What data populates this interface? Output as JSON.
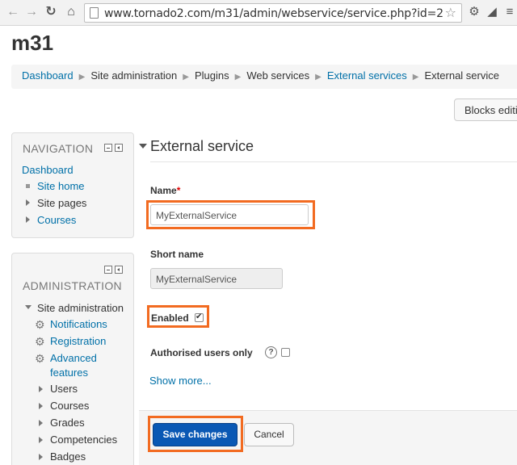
{
  "browser": {
    "url": "www.tornado2.com/m31/admin/webservice/service.php?id=2",
    "icons": [
      "back-arrow-icon",
      "forward-arrow-icon",
      "reload-icon",
      "home-icon",
      "star-icon"
    ]
  },
  "site": {
    "title": "m31"
  },
  "breadcrumb": [
    {
      "label": "Dashboard",
      "link": true
    },
    {
      "label": "Site administration",
      "link": false
    },
    {
      "label": "Plugins",
      "link": false
    },
    {
      "label": "Web services",
      "link": false
    },
    {
      "label": "External services",
      "link": true
    },
    {
      "label": "External service",
      "link": false
    }
  ],
  "blocks_button": {
    "label": "Blocks editi"
  },
  "navigation": {
    "title": "NAVIGATION",
    "dashboard": "Dashboard",
    "items": [
      "Site home",
      "Site pages",
      "Courses"
    ]
  },
  "administration": {
    "title": "ADMINISTRATION",
    "root": "Site administration",
    "gear_items": [
      "Notifications",
      "Registration",
      "Advanced",
      "features"
    ],
    "items": [
      "Users",
      "Courses",
      "Grades",
      "Competencies",
      "Badges"
    ]
  },
  "form": {
    "section_title": "External service",
    "name_label": "Name",
    "required_mark": "*",
    "name_value": "MyExternalService",
    "shortname_label": "Short name",
    "shortname_value": "MyExternalService",
    "enabled_label": "Enabled",
    "enabled_checked": true,
    "authorised_label": "Authorised users only",
    "authorised_checked": false,
    "show_more": "Show more...",
    "save_label": "Save changes",
    "cancel_label": "Cancel"
  },
  "colors": {
    "highlight": "#f26b21",
    "link": "#0070a8",
    "primary": "#0a58b4"
  }
}
